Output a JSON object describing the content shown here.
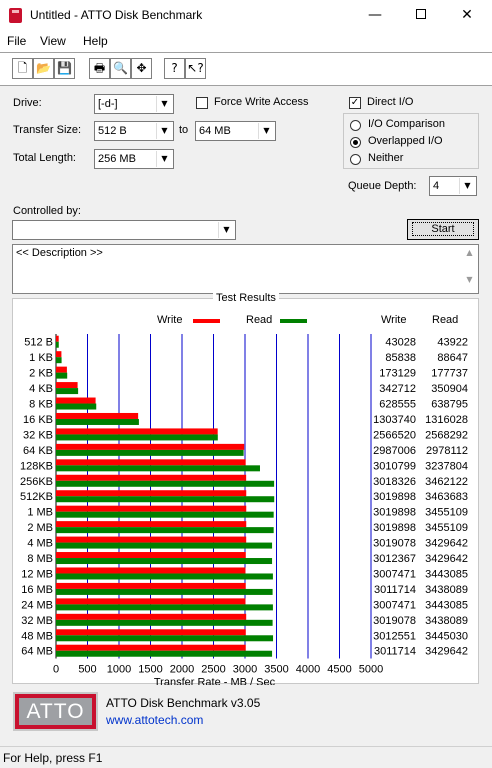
{
  "window": {
    "title": "Untitled - ATTO Disk Benchmark",
    "minimize": "—",
    "close": "✕"
  },
  "menu": {
    "file": "File",
    "view": "View",
    "help": "Help"
  },
  "toolbar": {
    "buttons": [
      {
        "name": "new-icon",
        "glyph": "🗋"
      },
      {
        "name": "open-icon",
        "glyph": "📂"
      },
      {
        "name": "save-icon",
        "glyph": "💾"
      },
      {
        "name": "print-icon",
        "glyph": "🖶"
      },
      {
        "name": "print-preview-icon",
        "glyph": "🔍"
      },
      {
        "name": "move-icon",
        "glyph": "✥"
      },
      {
        "name": "help-icon",
        "glyph": "?"
      },
      {
        "name": "context-help-icon",
        "glyph": "↖?"
      }
    ]
  },
  "settings": {
    "drive_label": "Drive:",
    "drive_value": "[-d-]",
    "force_write_access_label": "Force Write Access",
    "direct_io_label": "Direct I/O",
    "direct_io_checked": true,
    "transfer_size_label": "Transfer Size:",
    "transfer_size_from": "512 B",
    "to_label": "to",
    "transfer_size_to": "64 MB",
    "total_length_label": "Total Length:",
    "total_length_value": "256 MB",
    "io_options": [
      "I/O Comparison",
      "Overlapped I/O",
      "Neither"
    ],
    "io_selected": "Overlapped I/O",
    "queue_depth_label": "Queue Depth:",
    "queue_depth_value": "4",
    "controlled_by_label": "Controlled by:",
    "controlled_by_value": "",
    "start_label": "Start",
    "description_placeholder": "<< Description >>"
  },
  "results": {
    "title": "Test Results",
    "legend_write": "Write",
    "legend_read": "Read",
    "col_write": "Write",
    "col_read": "Read",
    "write_color": "#ff0000",
    "read_color": "#008000",
    "grid_color": "#0000cc"
  },
  "chart_data": {
    "type": "bar",
    "orientation": "horizontal",
    "categories": [
      "512 B",
      "1 KB",
      "2 KB",
      "4 KB",
      "8 KB",
      "16 KB",
      "32 KB",
      "64 KB",
      "128KB",
      "256KB",
      "512KB",
      "1 MB",
      "2 MB",
      "4 MB",
      "8 MB",
      "12 MB",
      "16 MB",
      "24 MB",
      "32 MB",
      "48 MB",
      "64 MB"
    ],
    "series": [
      {
        "name": "Write",
        "values": [
          43028,
          85838,
          173129,
          342712,
          628555,
          1303740,
          2566520,
          2987006,
          3010799,
          3018326,
          3019898,
          3019898,
          3019898,
          3019078,
          3012367,
          3007471,
          3011714,
          3007471,
          3019078,
          3012551,
          3011714
        ]
      },
      {
        "name": "Read",
        "values": [
          43922,
          88647,
          177737,
          350904,
          638795,
          1316028,
          2568292,
          2978112,
          3237804,
          3462122,
          3463683,
          3455109,
          3455109,
          3429642,
          3429642,
          3443085,
          3438089,
          3443085,
          3438089,
          3445030,
          3429642
        ]
      }
    ],
    "xlabel": "Transfer Rate - MB / Sec",
    "xticks": [
      "0",
      "500",
      "1000",
      "1500",
      "2000",
      "2500",
      "3000",
      "3500",
      "4000",
      "4500",
      "5000"
    ],
    "xlim": [
      0,
      5000
    ]
  },
  "footer": {
    "logo_text": "ATTO",
    "version": "ATTO Disk Benchmark v3.05",
    "website": "www.attotech.com"
  },
  "status": {
    "text": "For Help, press F1"
  }
}
